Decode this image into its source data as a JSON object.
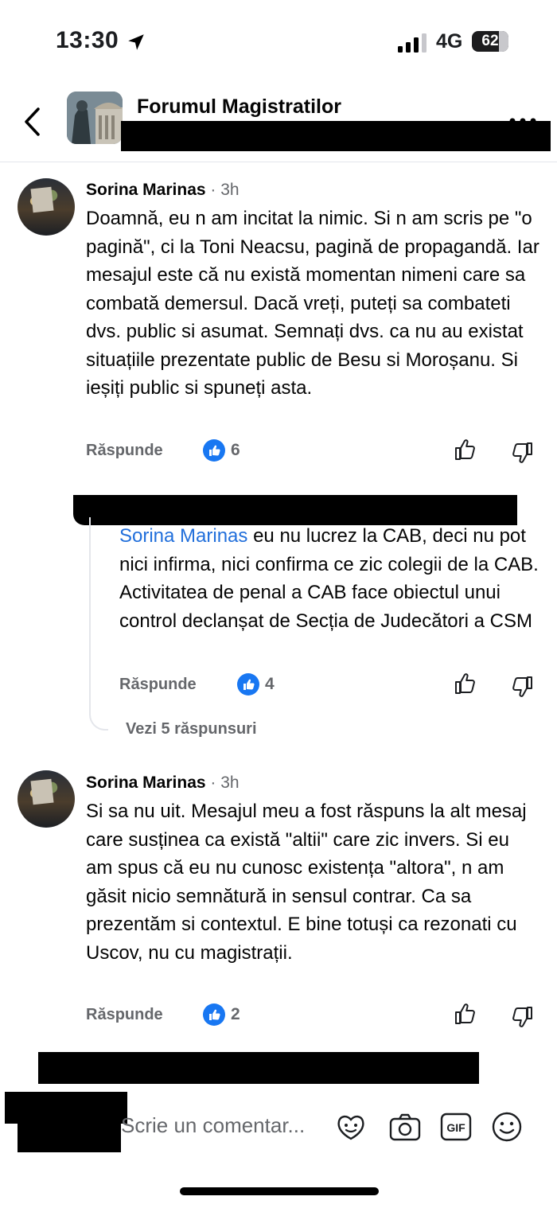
{
  "status_bar": {
    "time": "13:30",
    "network": "4G",
    "battery": "62"
  },
  "header": {
    "title": "Forumul Magistratilor"
  },
  "comments": [
    {
      "author": "Sorina Marinas",
      "meta": "· 3h",
      "text": "Doamnă, eu n am incitat la nimic. Si n am scris pe \"o pagină\", ci la Toni Neacsu, pagină de propagandă. Iar mesajul este că nu există momentan nimeni care sa combată demersul. Dacă vreți, puteți sa combateti dvs. public si asumat. Semnați dvs. ca nu au existat situațiile prezentate public de Besu si Moroșanu. Si ieșiți public si spuneți asta.",
      "reply_label": "Răspunde",
      "likes": "6"
    },
    {
      "mention": "Sorina Marinas",
      "text": " eu nu lucrez la CAB, deci nu pot nici infirma, nici confirma ce zic colegii de la CAB. Activitatea de penal a CAB face obiectul unui control declanșat de Secția de Judecători a CSM",
      "reply_label": "Răspunde",
      "likes": "4"
    },
    {
      "author": "Sorina Marinas",
      "meta": "· 3h",
      "text": "Si sa nu uit. Mesajul meu a fost răspuns la alt mesaj care susținea ca există \"altii\" care zic invers. Si eu am spus că eu nu cunosc existența \"altora\", n am găsit nicio semnătură in sensul contrar. Ca sa prezentăm si contextul. E bine totuși ca rezonati cu Uscov, nu cu magistrații.",
      "reply_label": "Răspunde",
      "likes": "2"
    }
  ],
  "view_replies": "Vezi 5 răspunsuri",
  "composer": {
    "placeholder": "Scrie un comentar..."
  },
  "icons": {
    "back": "chevron-left-icon",
    "more": "more-dots-icon",
    "like": "thumbs-up-icon",
    "dislike": "thumbs-down-icon",
    "avatar_sticker": "avatar-sticker-icon",
    "camera": "camera-icon",
    "gif": "gif-icon",
    "emoji": "emoji-icon"
  },
  "colors": {
    "accent": "#1877f2",
    "mention": "#216fdb",
    "muted": "#65676b",
    "redaction": "#000000"
  }
}
